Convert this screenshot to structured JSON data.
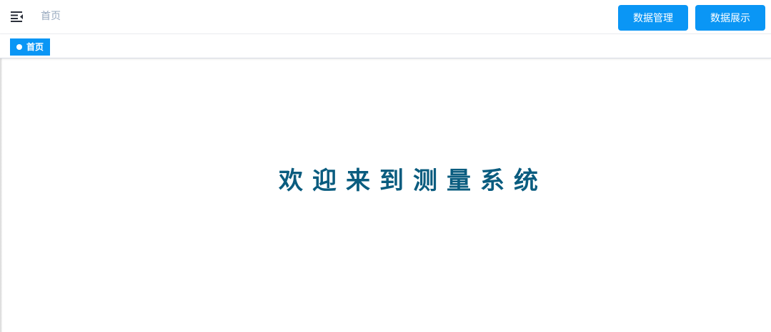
{
  "header": {
    "menu_icon": "hamburger-fold-icon",
    "breadcrumb": "首页",
    "buttons": {
      "data_management": "数据管理",
      "data_display": "数据展示"
    }
  },
  "tags": {
    "active_tag": "首页"
  },
  "main": {
    "welcome_text": "欢迎来到测量系统"
  },
  "colors": {
    "primary": "#0a96f5",
    "welcome_text": "#0a5c7f",
    "breadcrumb": "#97a8be"
  }
}
